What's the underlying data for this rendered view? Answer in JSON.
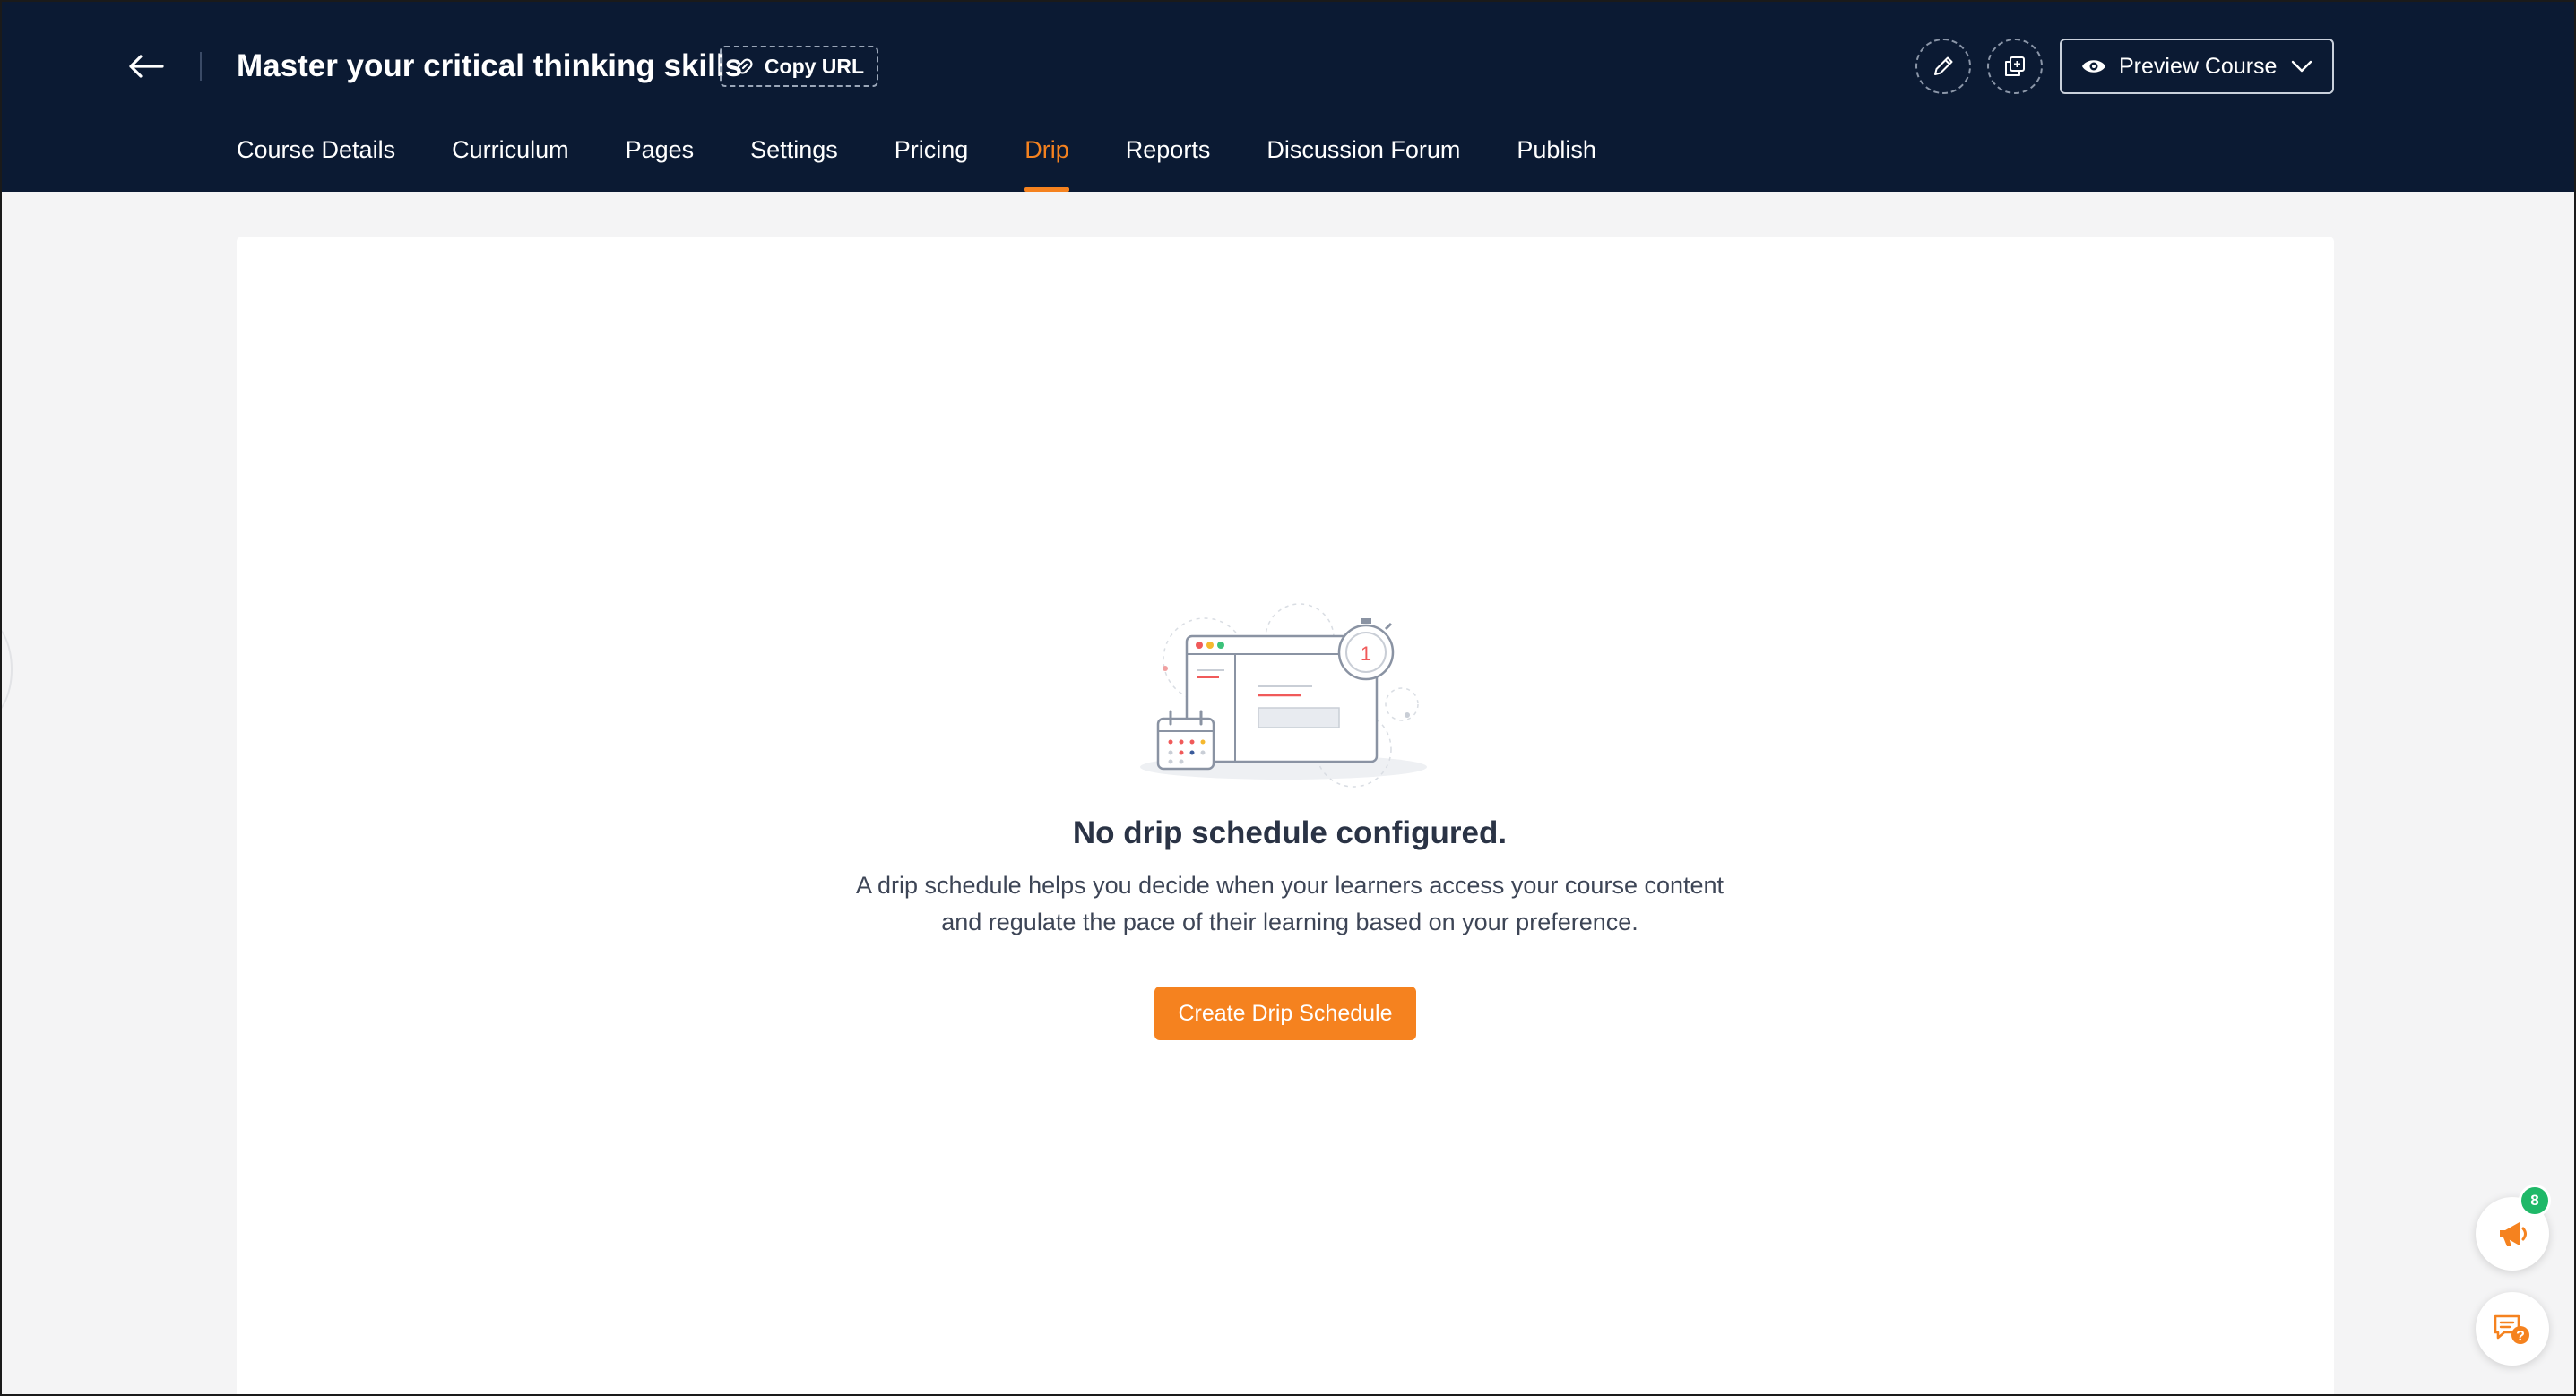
{
  "header": {
    "course_title": "Master your critical thinking skills",
    "copy_url_label": "Copy URL",
    "preview_label": "Preview Course",
    "background_color": "#0b1a33"
  },
  "tabs": [
    {
      "label": "Course Details",
      "active": false
    },
    {
      "label": "Curriculum",
      "active": false
    },
    {
      "label": "Pages",
      "active": false
    },
    {
      "label": "Settings",
      "active": false
    },
    {
      "label": "Pricing",
      "active": false
    },
    {
      "label": "Drip",
      "active": true
    },
    {
      "label": "Reports",
      "active": false
    },
    {
      "label": "Discussion Forum",
      "active": false
    },
    {
      "label": "Publish",
      "active": false
    }
  ],
  "empty_state": {
    "title": "No drip schedule configured.",
    "description_line1": "A drip schedule helps you decide when your learners access your course content",
    "description_line2": "and regulate the pace of their learning based on your preference.",
    "button_label": "Create Drip Schedule",
    "timer_number": "1"
  },
  "floating": {
    "announcements_count": "8"
  },
  "colors": {
    "accent": "#f5821f",
    "badge": "#1fb868"
  },
  "icons": [
    "back-arrow-icon",
    "link-icon",
    "pencil-icon",
    "duplicate-icon",
    "eye-icon",
    "chevron-down-icon",
    "megaphone-icon",
    "chat-help-icon"
  ]
}
